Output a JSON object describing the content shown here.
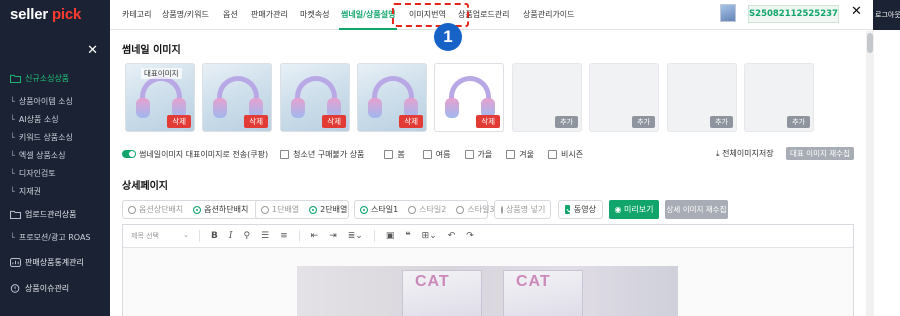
{
  "brand": {
    "part1": "seller",
    "part2": "pick"
  },
  "sidebar": {
    "sections": [
      {
        "label": "신규소싱상품",
        "active": true
      },
      {
        "label": "업로드관리상품",
        "active": false
      },
      {
        "label": "판매상품통계관리",
        "active": false
      },
      {
        "label": "상품이슈관리",
        "active": false
      }
    ],
    "sub_items": [
      "상품아이템 소싱",
      "AI상품 소싱",
      "키워드 상품소싱",
      "엑셀 상품소싱",
      "디자인검토",
      "지재권"
    ],
    "promo_item": "프로모션/광고 ROAS"
  },
  "tabs": [
    "카테고리",
    "상품명/키워드",
    "옵션",
    "판매가관리",
    "마켓속성",
    "썸네일/상품설명",
    "이미지번역",
    "상품업로드관리",
    "상품관리가이드"
  ],
  "active_tab": "썸네일/상품설명",
  "step_badge": "1",
  "arrow_glyph": "↓",
  "order_code": "S25082112525237",
  "login_label": "로그아웃",
  "thumbnail_section": {
    "title": "썸네일 이미지",
    "representative_label": "대표이미지",
    "delete_label": "삭제",
    "add_label": "추가",
    "send_toggle_label": "썸네일이미지 대표이미지로 전송(쿠팡)",
    "youth_label": "청소년 구매불가 상품",
    "seasons": [
      "봄",
      "여름",
      "가을",
      "겨울",
      "비시즌"
    ],
    "download_label": "전체이미지저장",
    "regen_label": "대표 이미지 재수집"
  },
  "detail_section": {
    "title": "상세페이지",
    "layout_options": [
      "옵션상단배치",
      "옵션하단배치"
    ],
    "column_options": [
      "1단배열",
      "2단배열"
    ],
    "style_options": [
      "스타일1",
      "스타일2",
      "스타일3"
    ],
    "add_name_label": "상품명 넣기",
    "video_label": "동영상",
    "preview_label": "미리보기",
    "regen_label": "상세 이미지 재수집"
  },
  "editor": {
    "heading_select_placeholder": "제목 선택",
    "product_text": "CAT"
  },
  "colors": {
    "accent": "#12a56b",
    "danger": "#e23b36",
    "sidebar_bg": "#1b2233",
    "badge": "#1662c7",
    "highlight": "#e5241b"
  }
}
